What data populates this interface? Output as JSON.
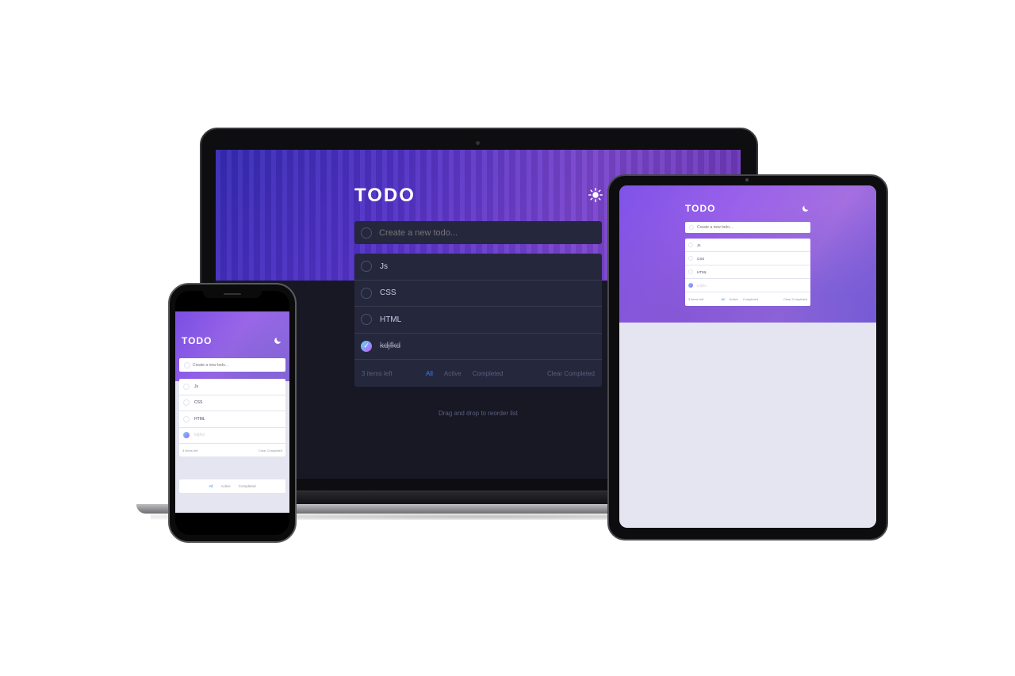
{
  "app": {
    "title": "TODO",
    "input_placeholder": "Create a new todo...",
    "drag_hint": "Drag and drop to reorder list"
  },
  "todos": [
    {
      "label": "Js",
      "completed": false
    },
    {
      "label": "CSS",
      "completed": false
    },
    {
      "label": "HTML",
      "completed": false
    },
    {
      "label": "kdjfkd",
      "completed": true
    }
  ],
  "footer": {
    "items_left": "3 items left",
    "filters": [
      "All",
      "Active",
      "Completed"
    ],
    "active_filter": "All",
    "clear": "Clear Completed"
  },
  "icons": {
    "laptop_theme": "sun-icon",
    "tablet_theme": "moon-icon",
    "phone_theme": "moon-icon",
    "check": "check-icon"
  },
  "colors": {
    "accent_blue": "#3a7cfd",
    "check_gradient_start": "#57ddff",
    "check_gradient_end": "#c058f3",
    "dark_card": "#25273d",
    "dark_bg": "#171823",
    "light_bg": "#e4e5f1"
  }
}
